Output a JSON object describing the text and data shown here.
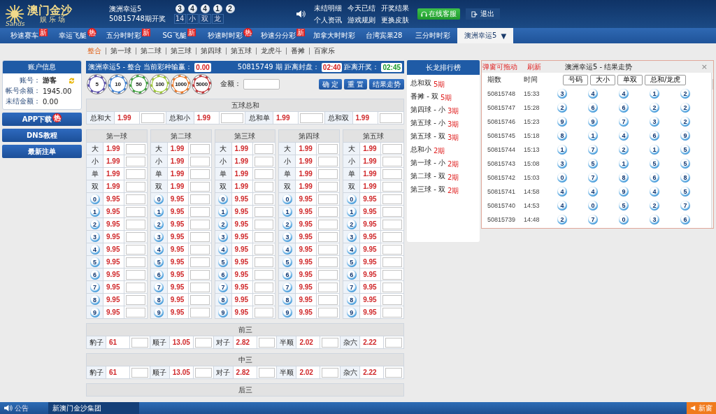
{
  "header": {
    "logo": {
      "title": "澳门金沙",
      "subtitle": "娱 乐 场",
      "brand": "Sands"
    },
    "lottery": {
      "name": "澳洲幸运5",
      "draw": "50815748期开奖",
      "balls": [
        "3",
        "4",
        "4",
        "1",
        "2"
      ],
      "stats": [
        "14",
        "小",
        "双",
        "龙"
      ]
    },
    "links": [
      "未结明细",
      "今天已结",
      "开奖结果",
      "个人资讯",
      "游戏规则",
      "更换皮肤"
    ],
    "service_button": "在线客服",
    "logout": "退出"
  },
  "nav_tabs": [
    {
      "label": "秒速赛车",
      "badge": {
        "text": "新",
        "kind": "new"
      },
      "selected": false
    },
    {
      "label": "幸运飞艇",
      "badge": {
        "text": "热",
        "kind": "hot"
      },
      "selected": false
    },
    {
      "label": "五分时时彩",
      "badge": {
        "text": "新",
        "kind": "new"
      },
      "selected": false
    },
    {
      "label": "SG飞艇",
      "badge": {
        "text": "新",
        "kind": "new"
      },
      "selected": false
    },
    {
      "label": "秒速时时彩",
      "badge": {
        "text": "热",
        "kind": "hot"
      },
      "selected": false
    },
    {
      "label": "秒速分分彩",
      "badge": {
        "text": "新",
        "kind": "new"
      },
      "selected": false
    },
    {
      "label": "加拿大时时彩",
      "selected": false
    },
    {
      "label": "台湾宾果28",
      "selected": false
    },
    {
      "label": "三分时时彩",
      "selected": false
    },
    {
      "label": "澳洲幸运5",
      "dropdown": "▼",
      "selected": true
    }
  ],
  "sub_tabs": [
    {
      "label": "整合",
      "selected": true
    },
    {
      "label": "第一球",
      "selected": false
    },
    {
      "label": "第二球",
      "selected": false
    },
    {
      "label": "第三球",
      "selected": false
    },
    {
      "label": "第四球",
      "selected": false
    },
    {
      "label": "第五球",
      "selected": false
    },
    {
      "label": "龙虎斗",
      "selected": false
    },
    {
      "label": "番摊",
      "selected": false
    },
    {
      "label": "百家乐",
      "selected": false
    }
  ],
  "account": {
    "title": "账户信息",
    "fields": [
      {
        "label": "账号：",
        "value": "游客",
        "refresh": true
      },
      {
        "label": "帐号余额：",
        "value": "1945.00"
      },
      {
        "label": "未结金额：",
        "value": "0.00"
      }
    ]
  },
  "sidebar_buttons": [
    {
      "label": "APP下载",
      "badge": {
        "text": "热",
        "kind": "hot"
      }
    },
    {
      "label": "DNS教程"
    },
    {
      "label": "最新注单"
    }
  ],
  "bet_header": {
    "title": "澳洲幸运5 - 整合",
    "winloss_label": "当前彩种输赢：",
    "winloss": "0.00",
    "period": "50815749 期",
    "close_label": "距离封盘：",
    "close_time": "02:40",
    "open_label": "距离开奖：",
    "open_time": "02:45"
  },
  "chips": [
    {
      "value": "5",
      "color": "#5a4fa8"
    },
    {
      "value": "10",
      "color": "#3f7fcf"
    },
    {
      "value": "50",
      "color": "#3f9f3f"
    },
    {
      "value": "100",
      "color": "#9fc73a"
    },
    {
      "value": "1000",
      "color": "#e9782a"
    },
    {
      "value": "5000",
      "color": "#c0393b"
    }
  ],
  "amount_label": "金额：",
  "action_buttons": [
    "确 定",
    "重 置",
    "结果走势"
  ],
  "sum_table": {
    "title": "五球总和",
    "cells": [
      {
        "label": "总和大",
        "odds": "1.99"
      },
      {
        "label": "总和小",
        "odds": "1.99"
      },
      {
        "label": "总和单",
        "odds": "1.99"
      },
      {
        "label": "总和双",
        "odds": "1.99"
      }
    ]
  },
  "ball_tables": [
    {
      "title": "第一球",
      "rows": [
        {
          "kind": "text",
          "label": "大",
          "odds": "1.99"
        },
        {
          "kind": "text",
          "label": "小",
          "odds": "1.99"
        },
        {
          "kind": "text",
          "label": "单",
          "odds": "1.99"
        },
        {
          "kind": "text",
          "label": "双",
          "odds": "1.99"
        },
        {
          "kind": "ball",
          "label": "0",
          "odds": "9.95"
        },
        {
          "kind": "ball",
          "label": "1",
          "odds": "9.95"
        },
        {
          "kind": "ball",
          "label": "2",
          "odds": "9.95"
        },
        {
          "kind": "ball",
          "label": "3",
          "odds": "9.95"
        },
        {
          "kind": "ball",
          "label": "4",
          "odds": "9.95"
        },
        {
          "kind": "ball",
          "label": "5",
          "odds": "9.95"
        },
        {
          "kind": "ball",
          "label": "6",
          "odds": "9.95"
        },
        {
          "kind": "ball",
          "label": "7",
          "odds": "9.95"
        },
        {
          "kind": "ball",
          "label": "8",
          "odds": "9.95"
        },
        {
          "kind": "ball",
          "label": "9",
          "odds": "9.95"
        }
      ]
    },
    {
      "title": "第二球",
      "rows": [
        {
          "kind": "text",
          "label": "大",
          "odds": "1.99"
        },
        {
          "kind": "text",
          "label": "小",
          "odds": "1.99"
        },
        {
          "kind": "text",
          "label": "单",
          "odds": "1.99"
        },
        {
          "kind": "text",
          "label": "双",
          "odds": "1.99"
        },
        {
          "kind": "ball",
          "label": "0",
          "odds": "9.95"
        },
        {
          "kind": "ball",
          "label": "1",
          "odds": "9.95"
        },
        {
          "kind": "ball",
          "label": "2",
          "odds": "9.95"
        },
        {
          "kind": "ball",
          "label": "3",
          "odds": "9.95"
        },
        {
          "kind": "ball",
          "label": "4",
          "odds": "9.95"
        },
        {
          "kind": "ball",
          "label": "5",
          "odds": "9.95"
        },
        {
          "kind": "ball",
          "label": "6",
          "odds": "9.95"
        },
        {
          "kind": "ball",
          "label": "7",
          "odds": "9.95"
        },
        {
          "kind": "ball",
          "label": "8",
          "odds": "9.95"
        },
        {
          "kind": "ball",
          "label": "9",
          "odds": "9.95"
        }
      ]
    },
    {
      "title": "第三球",
      "rows": [
        {
          "kind": "text",
          "label": "大",
          "odds": "1.99"
        },
        {
          "kind": "text",
          "label": "小",
          "odds": "1.99"
        },
        {
          "kind": "text",
          "label": "单",
          "odds": "1.99"
        },
        {
          "kind": "text",
          "label": "双",
          "odds": "1.99"
        },
        {
          "kind": "ball",
          "label": "0",
          "odds": "9.95"
        },
        {
          "kind": "ball",
          "label": "1",
          "odds": "9.95"
        },
        {
          "kind": "ball",
          "label": "2",
          "odds": "9.95"
        },
        {
          "kind": "ball",
          "label": "3",
          "odds": "9.95"
        },
        {
          "kind": "ball",
          "label": "4",
          "odds": "9.95"
        },
        {
          "kind": "ball",
          "label": "5",
          "odds": "9.95"
        },
        {
          "kind": "ball",
          "label": "6",
          "odds": "9.95"
        },
        {
          "kind": "ball",
          "label": "7",
          "odds": "9.95"
        },
        {
          "kind": "ball",
          "label": "8",
          "odds": "9.95"
        },
        {
          "kind": "ball",
          "label": "9",
          "odds": "9.95"
        }
      ]
    },
    {
      "title": "第四球",
      "rows": [
        {
          "kind": "text",
          "label": "大",
          "odds": "1.99"
        },
        {
          "kind": "text",
          "label": "小",
          "odds": "1.99"
        },
        {
          "kind": "text",
          "label": "单",
          "odds": "1.99"
        },
        {
          "kind": "text",
          "label": "双",
          "odds": "1.99"
        },
        {
          "kind": "ball",
          "label": "0",
          "odds": "9.95"
        },
        {
          "kind": "ball",
          "label": "1",
          "odds": "9.95"
        },
        {
          "kind": "ball",
          "label": "2",
          "odds": "9.95"
        },
        {
          "kind": "ball",
          "label": "3",
          "odds": "9.95"
        },
        {
          "kind": "ball",
          "label": "4",
          "odds": "9.95"
        },
        {
          "kind": "ball",
          "label": "5",
          "odds": "9.95"
        },
        {
          "kind": "ball",
          "label": "6",
          "odds": "9.95"
        },
        {
          "kind": "ball",
          "label": "7",
          "odds": "9.95"
        },
        {
          "kind": "ball",
          "label": "8",
          "odds": "9.95"
        },
        {
          "kind": "ball",
          "label": "9",
          "odds": "9.95"
        }
      ]
    },
    {
      "title": "第五球",
      "rows": [
        {
          "kind": "text",
          "label": "大",
          "odds": "1.99"
        },
        {
          "kind": "text",
          "label": "小",
          "odds": "1.99"
        },
        {
          "kind": "text",
          "label": "单",
          "odds": "1.99"
        },
        {
          "kind": "text",
          "label": "双",
          "odds": "1.99"
        },
        {
          "kind": "ball",
          "label": "0",
          "odds": "9.95"
        },
        {
          "kind": "ball",
          "label": "1",
          "odds": "9.95"
        },
        {
          "kind": "ball",
          "label": "2",
          "odds": "9.95"
        },
        {
          "kind": "ball",
          "label": "3",
          "odds": "9.95"
        },
        {
          "kind": "ball",
          "label": "4",
          "odds": "9.95"
        },
        {
          "kind": "ball",
          "label": "5",
          "odds": "9.95"
        },
        {
          "kind": "ball",
          "label": "6",
          "odds": "9.95"
        },
        {
          "kind": "ball",
          "label": "7",
          "odds": "9.95"
        },
        {
          "kind": "ball",
          "label": "8",
          "odds": "9.95"
        },
        {
          "kind": "ball",
          "label": "9",
          "odds": "9.95"
        }
      ]
    }
  ],
  "combo_tables": [
    {
      "title": "前三",
      "cells": [
        {
          "label": "豹子",
          "odds": "61"
        },
        {
          "label": "顺子",
          "odds": "13.05"
        },
        {
          "label": "对子",
          "odds": "2.82"
        },
        {
          "label": "半顺",
          "odds": "2.02"
        },
        {
          "label": "杂六",
          "odds": "2.22"
        }
      ]
    },
    {
      "title": "中三",
      "cells": [
        {
          "label": "豹子",
          "odds": "61"
        },
        {
          "label": "顺子",
          "odds": "13.05"
        },
        {
          "label": "对子",
          "odds": "2.82"
        },
        {
          "label": "半顺",
          "odds": "2.02"
        },
        {
          "label": "杂六",
          "odds": "2.22"
        }
      ]
    },
    {
      "title": "后三"
    }
  ],
  "long_dragon": {
    "title": "长龙排行榜",
    "items": [
      {
        "label": "总和双",
        "count": "5期"
      },
      {
        "label": "番摊 - 双",
        "count": "5期"
      },
      {
        "label": "第四球 - 小",
        "count": "3期"
      },
      {
        "label": "第五球 - 小",
        "count": "3期"
      },
      {
        "label": "第五球 - 双",
        "count": "3期"
      },
      {
        "label": "总和小",
        "count": "2期"
      },
      {
        "label": "第一球 - 小",
        "count": "2期"
      },
      {
        "label": "第二球 - 双",
        "count": "2期"
      },
      {
        "label": "第三球 - 双",
        "count": "2期"
      }
    ]
  },
  "results_popup": {
    "hint": "弹窗可拖动",
    "refresh": "刷新",
    "title": "澳洲幸运5 - 结果走势",
    "close": "×",
    "columns": [
      "期数",
      "时间"
    ],
    "tabs": [
      "号码",
      "大小",
      "单双",
      "总和/龙虎"
    ],
    "rows": [
      {
        "period": "50815748",
        "time": "15:33",
        "balls": [
          "3",
          "4",
          "4",
          "1",
          "2"
        ]
      },
      {
        "period": "50815747",
        "time": "15:28",
        "balls": [
          "2",
          "6",
          "6",
          "2",
          "2"
        ]
      },
      {
        "period": "50815746",
        "time": "15:23",
        "balls": [
          "9",
          "9",
          "7",
          "3",
          "2"
        ]
      },
      {
        "period": "50815745",
        "time": "15:18",
        "balls": [
          "8",
          "1",
          "4",
          "6",
          "9"
        ]
      },
      {
        "period": "50815744",
        "time": "15:13",
        "balls": [
          "1",
          "7",
          "2",
          "1",
          "5"
        ]
      },
      {
        "period": "50815743",
        "time": "15:08",
        "balls": [
          "3",
          "5",
          "1",
          "5",
          "5"
        ]
      },
      {
        "period": "50815742",
        "time": "15:03",
        "balls": [
          "0",
          "7",
          "8",
          "6",
          "8"
        ]
      },
      {
        "period": "50815741",
        "time": "14:58",
        "balls": [
          "4",
          "4",
          "9",
          "4",
          "5"
        ]
      },
      {
        "period": "50815740",
        "time": "14:53",
        "balls": [
          "4",
          "0",
          "5",
          "2",
          "7"
        ]
      },
      {
        "period": "50815739",
        "time": "14:48",
        "balls": [
          "2",
          "7",
          "0",
          "3",
          "6"
        ]
      }
    ]
  },
  "footer": {
    "label": "公告",
    "notice": "新澳门金沙集团",
    "right": "新窗"
  }
}
